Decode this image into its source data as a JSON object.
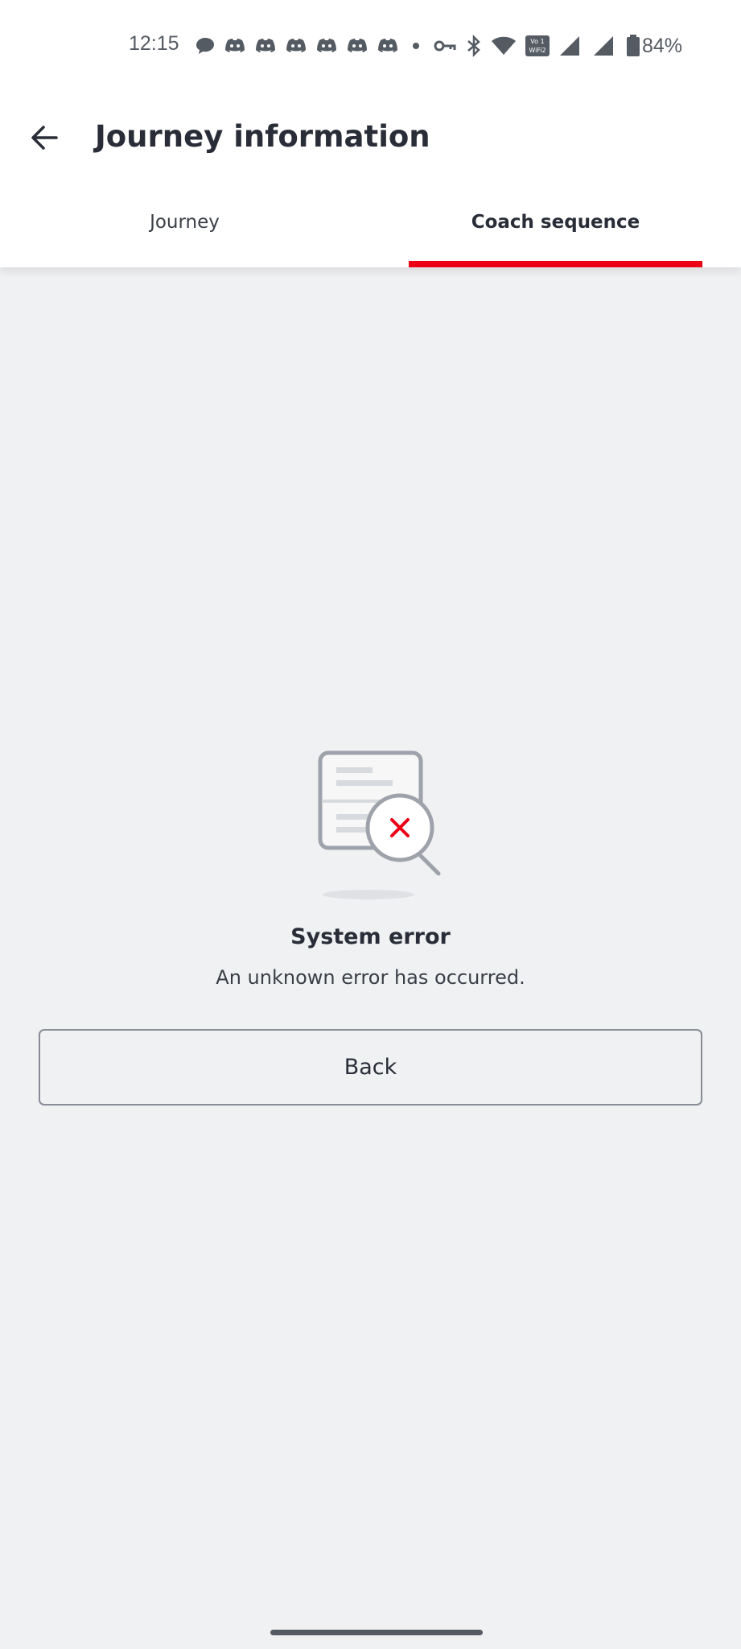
{
  "status_bar": {
    "time": "12:15",
    "battery": "84%",
    "icons": [
      "chat-bubble-icon",
      "discord-icon",
      "discord-icon",
      "discord-icon",
      "discord-icon",
      "discord-icon",
      "discord-icon",
      "dot-icon",
      "vpn-key-icon",
      "bluetooth-icon",
      "wifi-icon",
      "vowifi-icon",
      "signal-icon",
      "signal-icon",
      "battery-icon"
    ],
    "vowifi_top": "Vo 1",
    "vowifi_bottom": "WiFi2"
  },
  "header": {
    "title": "Journey information"
  },
  "tabs": [
    {
      "label": "Journey",
      "selected": false
    },
    {
      "label": "Coach sequence",
      "selected": true
    }
  ],
  "error": {
    "title": "System error",
    "message": "An unknown error has occurred."
  },
  "buttons": {
    "back_label": "Back"
  },
  "colors": {
    "accent_red": "#ec0016",
    "background": "#f0f1f3",
    "text": "#282d37"
  }
}
